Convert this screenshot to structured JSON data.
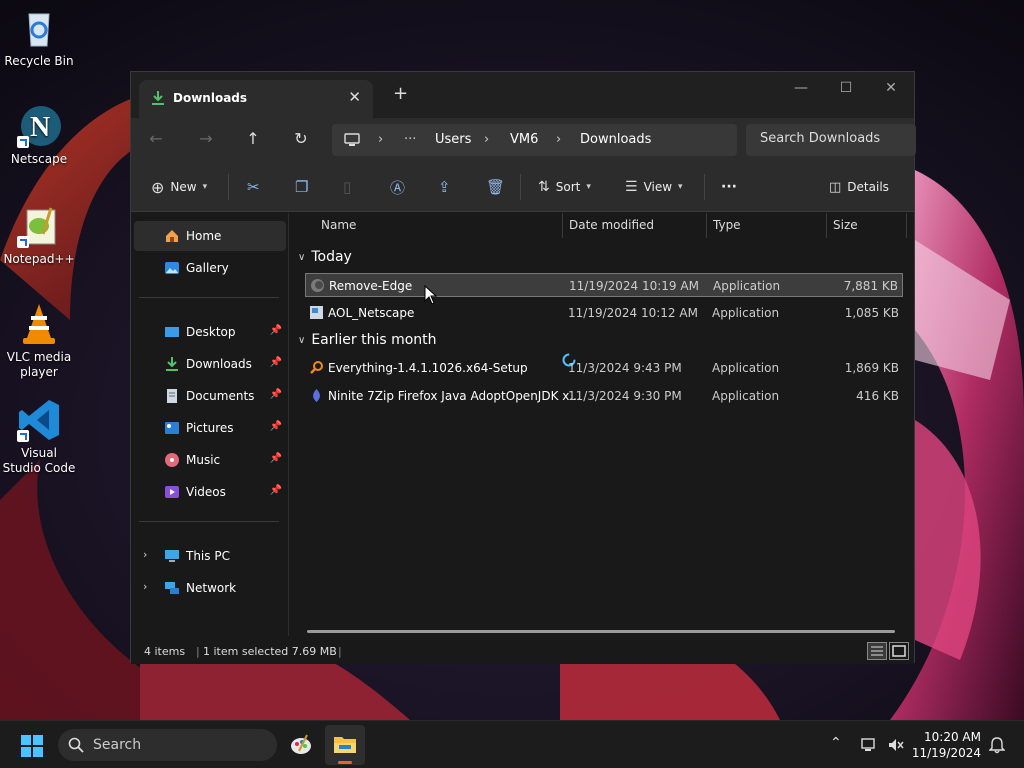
{
  "desktop": {
    "icons": [
      {
        "label": "Recycle Bin"
      },
      {
        "label": "Netscape"
      },
      {
        "label": "Notepad++"
      },
      {
        "label": "VLC media player"
      },
      {
        "label": "Visual Studio Code"
      }
    ]
  },
  "window": {
    "tab_title": "Downloads",
    "tab_close": "✕",
    "new_tab": "+",
    "controls": {
      "minimize": "—",
      "maximize": "☐",
      "close": "✕"
    }
  },
  "navbar": {
    "back": "←",
    "forward": "→",
    "up": "↑",
    "refresh": "↻",
    "breadcrumb": {
      "more": "···",
      "separator": "›",
      "items": [
        "Users",
        "VM6",
        "Downloads"
      ]
    },
    "search_placeholder": "Search Downloads"
  },
  "toolbar": {
    "new_label": "New",
    "sort_label": "Sort",
    "view_label": "View",
    "more": "···",
    "details_label": "Details"
  },
  "sidebar": {
    "top": [
      {
        "label": "Home"
      },
      {
        "label": "Gallery"
      }
    ],
    "pinned": [
      {
        "label": "Desktop"
      },
      {
        "label": "Downloads"
      },
      {
        "label": "Documents"
      },
      {
        "label": "Pictures"
      },
      {
        "label": "Music"
      },
      {
        "label": "Videos"
      }
    ],
    "bottom": [
      {
        "label": "This PC"
      },
      {
        "label": "Network"
      }
    ]
  },
  "columns": {
    "name": "Name",
    "date": "Date modified",
    "type": "Type",
    "size": "Size"
  },
  "groups": [
    {
      "title": "Today",
      "files": [
        {
          "name": "Remove-Edge",
          "date": "11/19/2024 10:19 AM",
          "type": "Application",
          "size": "7,881 KB",
          "selected": true
        },
        {
          "name": "AOL_Netscape",
          "date": "11/19/2024 10:12 AM",
          "type": "Application",
          "size": "1,085 KB",
          "selected": false
        }
      ]
    },
    {
      "title": "Earlier this month",
      "files": [
        {
          "name": "Everything-1.4.1.1026.x64-Setup",
          "date": "11/3/2024 9:43 PM",
          "type": "Application",
          "size": "1,869 KB",
          "selected": false
        },
        {
          "name": "Ninite 7Zip Firefox Java AdoptOpenJDK x...",
          "date": "11/3/2024 9:30 PM",
          "type": "Application",
          "size": "416 KB",
          "selected": false
        }
      ]
    }
  ],
  "status": {
    "count": "4 items",
    "selection": "1 item selected  7.69 MB"
  },
  "taskbar": {
    "search_label": "Search",
    "time": "10:20 AM",
    "date": "11/19/2024"
  },
  "colors": {
    "accent": "#4cc2ff",
    "window_bg": "#191919",
    "taskbar_bg": "#1c1c1c"
  }
}
